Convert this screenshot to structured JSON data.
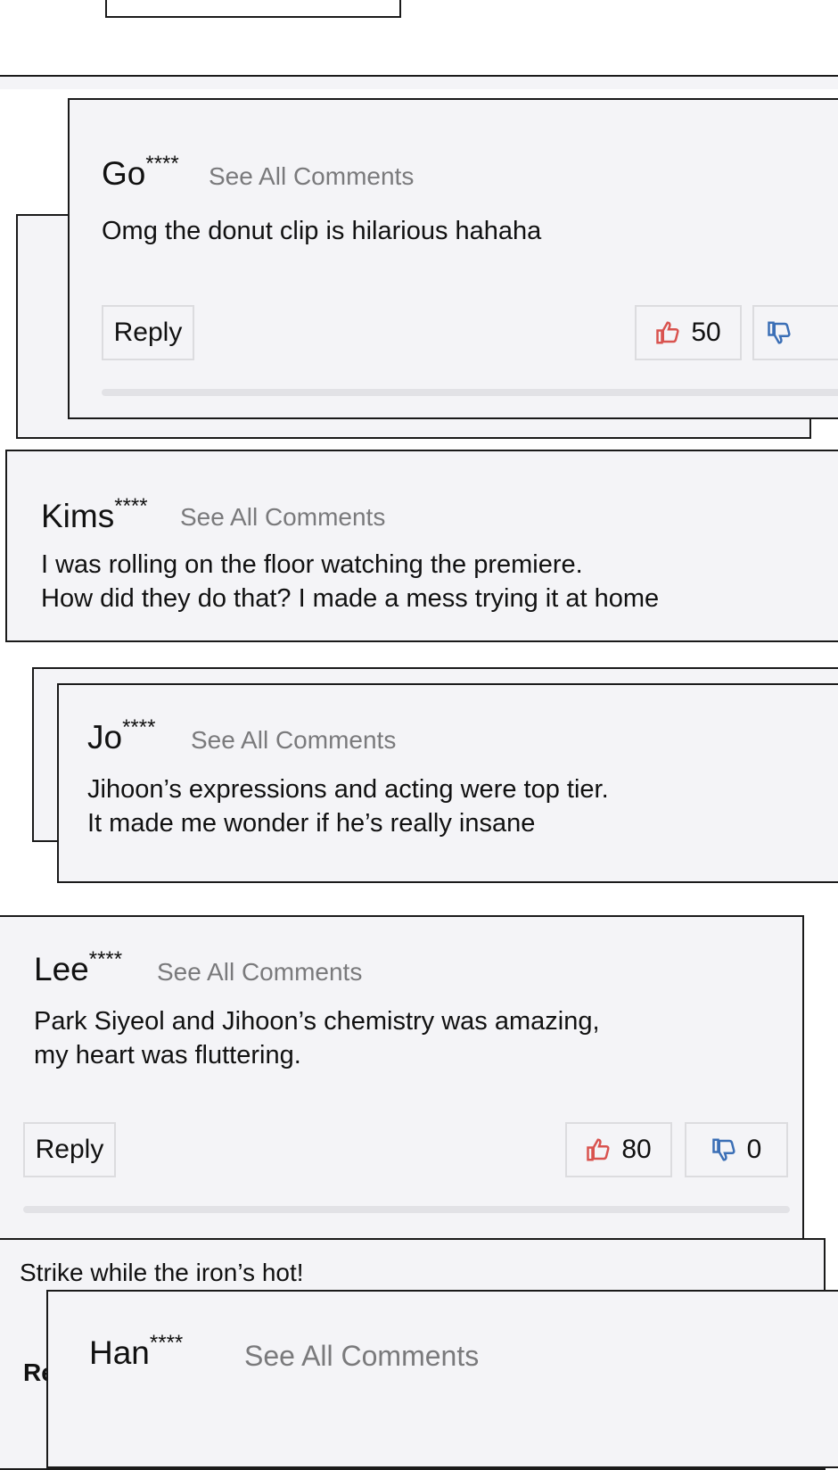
{
  "see_all": "See All Comments",
  "reply_label": "Reply",
  "asterisks": "****",
  "comments": [
    {
      "user": "Go",
      "lines": [
        "Omg the donut clip is hilarious hahaha"
      ],
      "likes": "50"
    },
    {
      "user": "Kims",
      "lines": [
        "I was rolling on the floor watching the premiere.",
        "How did they do that? I made a mess trying it at home"
      ]
    },
    {
      "user": "Jo",
      "lines": [
        "Jihoon’s expressions and acting were top tier.",
        "It made me wonder if he’s really insane"
      ]
    },
    {
      "user": "Lee",
      "lines": [
        "Park Siyeol and Jihoon’s chemistry was amazing,",
        "my heart was fluttering."
      ],
      "likes": "80",
      "dislikes": "0"
    },
    {
      "user": "Han",
      "lines": []
    }
  ],
  "partial_comment": "Strike while the iron’s hot!",
  "partial_reply": "Re",
  "colors": {
    "like": "#d9534f",
    "dislike": "#3b6fb6",
    "panel": "#f4f4f7",
    "border": "#1a1a1a"
  }
}
